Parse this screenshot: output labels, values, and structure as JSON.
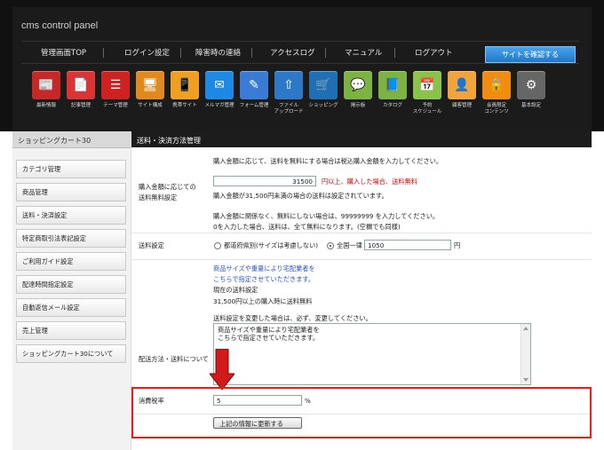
{
  "app_title": "cms control panel",
  "nav": [
    {
      "label": "管理画面TOP"
    },
    {
      "label": "ログイン設定"
    },
    {
      "label": "障害時の連絡"
    },
    {
      "label": "アクセスログ"
    },
    {
      "label": "マニュアル"
    },
    {
      "label": "ログアウト"
    }
  ],
  "site_button": "サイトを確認する",
  "icons": [
    {
      "label": "最新情報",
      "icon": "news-icon",
      "color": "#c62828"
    },
    {
      "label": "記事管理",
      "icon": "document-icon",
      "color": "#d33"
    },
    {
      "label": "テーマ管理",
      "icon": "list-icon",
      "color": "#c22"
    },
    {
      "label": "サイト構成",
      "icon": "monitor-icon",
      "color": "#e08a1e"
    },
    {
      "label": "携帯サイト",
      "icon": "mobile-icon",
      "color": "#f0a020"
    },
    {
      "label": "メルマガ管理",
      "icon": "mail-icon",
      "color": "#1e88e5"
    },
    {
      "label": "フォーム管理",
      "icon": "form-icon",
      "color": "#3a7bd5"
    },
    {
      "label": "ファイル\nアップロード",
      "icon": "file-upload-icon",
      "color": "#2d79c7"
    },
    {
      "label": "ショッピング",
      "icon": "cart-icon",
      "color": "#1f6fb5"
    },
    {
      "label": "掲示板",
      "icon": "bbs-icon",
      "color": "#7cb342"
    },
    {
      "label": "カタログ",
      "icon": "catalog-icon",
      "color": "#7cb342"
    },
    {
      "label": "予約\nスケジュール",
      "icon": "calendar-icon",
      "color": "#8bc34a"
    },
    {
      "label": "顧客管理",
      "icon": "customer-icon",
      "color": "#f2a33a"
    },
    {
      "label": "会員限定\nコンテンツ",
      "icon": "lock-icon",
      "color": "#f28c0f"
    },
    {
      "label": "基本設定",
      "icon": "gear-icon",
      "color": "#666666"
    }
  ],
  "sidebar": {
    "title": "ショッピングカート30",
    "items": [
      {
        "label": "カテゴリ管理"
      },
      {
        "label": "商品管理"
      },
      {
        "label": "送料・決済設定"
      },
      {
        "label": "特定商取引法表記設定"
      },
      {
        "label": "ご利用ガイド設定"
      },
      {
        "label": "配達時間指定設定"
      },
      {
        "label": "自動返信メール設定"
      },
      {
        "label": "売上管理"
      },
      {
        "label": "ショッピングカート30について"
      }
    ]
  },
  "main": {
    "header": "送料・決済方法管理",
    "free_shipping": {
      "label_line1": "購入金額に応じての",
      "label_line2": "送料無料設定",
      "intro": "購入金額に応じて、送料を無料にする場合は税込購入金額を入力してください。",
      "amount": "31500",
      "amount_suffix": "円以上、購入した場合、送料無料",
      "note1": "購入金額が31,500円未満の場合の送料は設定されています。",
      "note2": "購入金額に関係なく、無料にしない場合は、99999999 を入力してください。",
      "note3": "0を入力した場合、送料は、全て無料になります。(空欄でも同様)"
    },
    "shipping": {
      "label": "送料設定",
      "option1": "都道府県別(サイズは考慮しない)",
      "option2": "全国一律",
      "value": "1050",
      "unit": "円"
    },
    "delivery": {
      "label": "配送方法・送料について",
      "blue_line1": "商品サイズや重量により宅配業者を",
      "blue_line2": "こちらで指定させていただきます。",
      "current_label": "現在の送料設定",
      "current_value": "31,500円以上の購入時に送料無料",
      "change_note": "送料設定を変更した場合は、必ず、変更してください。",
      "textarea_line1": "商品サイズや重量により宅配業者を",
      "textarea_line2": "こちらで指定させていただきます。"
    },
    "tax": {
      "label": "消費税率",
      "value": "5",
      "unit": "%"
    },
    "update_button": "上記の情報に更新する"
  }
}
